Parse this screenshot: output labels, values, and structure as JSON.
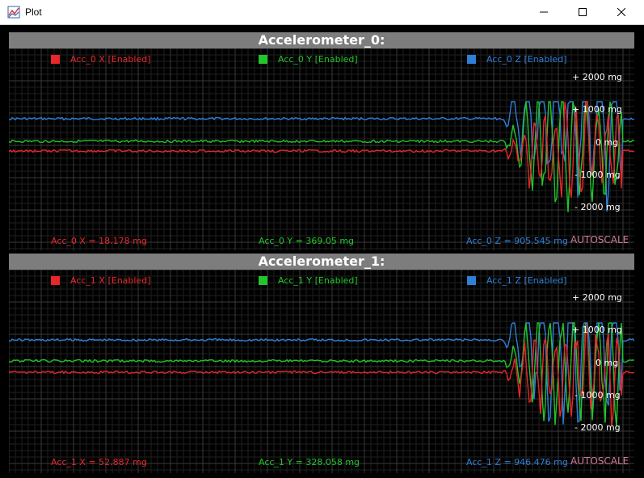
{
  "window": {
    "title": "Plot"
  },
  "colors": {
    "x_series": "#e8272a",
    "y_series": "#22c52b",
    "z_series": "#2f7fd8",
    "header_bg": "#7d7d7d",
    "autoscale": "#d07a9a"
  },
  "panels": [
    {
      "title": "Accelerometer_0:",
      "legend": [
        {
          "label": "Acc_0 X [Enabled]"
        },
        {
          "label": "Acc_0 Y [Enabled]"
        },
        {
          "label": "Acc_0 Z [Enabled]"
        }
      ],
      "readouts": [
        {
          "text": "Acc_0 X = 18.178 mg"
        },
        {
          "text": "Acc_0 Y = 369.05 mg"
        },
        {
          "text": "Acc_0 Z = 905.545 mg"
        }
      ],
      "autoscale_label": "AUTOSCALE",
      "axis_labels": [
        "+ 2000 mg",
        "+ 1000 mg",
        "0 mg",
        "- 1000 mg",
        "- 2000 mg"
      ]
    },
    {
      "title": "Accelerometer_1:",
      "legend": [
        {
          "label": "Acc_1 X [Enabled]"
        },
        {
          "label": "Acc_1 Y [Enabled]"
        },
        {
          "label": "Acc_1 Z [Enabled]"
        }
      ],
      "readouts": [
        {
          "text": "Acc_1 X = 52.887 mg"
        },
        {
          "text": "Acc_1 Y = 328.058 mg"
        },
        {
          "text": "Acc_1 Z = 946.476 mg"
        }
      ],
      "autoscale_label": "AUTOSCALE",
      "axis_labels": [
        "+ 2000 mg",
        "+ 1000 mg",
        "0 mg",
        "- 1000 mg",
        "- 2000 mg"
      ]
    }
  ]
}
